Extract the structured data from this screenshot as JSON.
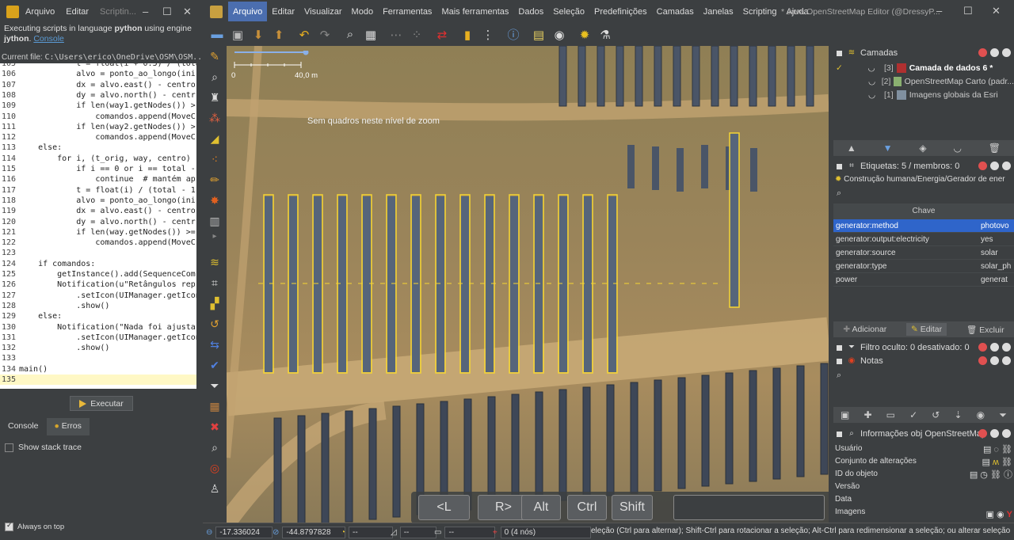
{
  "script_window": {
    "menus": [
      "Arquivo",
      "Editar",
      "Scriptin..."
    ],
    "message": "Executing scripts in language ",
    "language": "python",
    "message2": " using engine ",
    "engine": "jython",
    "message3": ". ",
    "link": "Console",
    "current_file_label": "Current file:",
    "current_file": "C:\\Users\\erico\\OneDrive\\OSM\\OSM...",
    "execute_label": "Executar",
    "tabs": [
      "Console",
      "Erros"
    ],
    "stack_trace_label": "Show stack trace",
    "always_on_top_label": "Always on top"
  },
  "code": {
    "lines": [
      {
        "n": "105",
        "t": "            t = float(i + 0.5) / (total"
      },
      {
        "n": "106",
        "t": "            alvo = ponto_ao_longo(ini"
      },
      {
        "n": "107",
        "t": "            dx = alvo.east() - centro"
      },
      {
        "n": "108",
        "t": "            dy = alvo.north() - centr"
      },
      {
        "n": "109",
        "t": "            if len(way1.getNodes()) >"
      },
      {
        "n": "110",
        "t": "                comandos.append(MoveC"
      },
      {
        "n": "111",
        "t": "            if len(way2.getNodes()) >"
      },
      {
        "n": "112",
        "t": "                comandos.append(MoveC"
      },
      {
        "n": "113",
        "t": "    else:"
      },
      {
        "n": "114",
        "t": "        for i, (t_orig, way, centro) "
      },
      {
        "n": "115",
        "t": "            if i == 0 or i == total -"
      },
      {
        "n": "116",
        "t": "                continue  # mantém ap"
      },
      {
        "n": "117",
        "t": "            t = float(i) / (total - 1"
      },
      {
        "n": "118",
        "t": "            alvo = ponto_ao_longo(ini"
      },
      {
        "n": "119",
        "t": "            dx = alvo.east() - centro"
      },
      {
        "n": "120",
        "t": "            dy = alvo.north() - centr"
      },
      {
        "n": "121",
        "t": "            if len(way.getNodes()) >="
      },
      {
        "n": "122",
        "t": "                comandos.append(MoveC"
      },
      {
        "n": "123",
        "t": ""
      },
      {
        "n": "124",
        "t": "    if comandos:"
      },
      {
        "n": "125",
        "t": "        getInstance().add(SequenceCom"
      },
      {
        "n": "126",
        "t": "        Notification(u\"Retângulos rep"
      },
      {
        "n": "127",
        "t": "            .setIcon(UIManager.getIcon(\"O"
      },
      {
        "n": "128",
        "t": "            .show()"
      },
      {
        "n": "129",
        "t": "    else:"
      },
      {
        "n": "130",
        "t": "        Notification(\"Nada foi ajusta"
      },
      {
        "n": "131",
        "t": "            .setIcon(UIManager.getIcon(\"O"
      },
      {
        "n": "132",
        "t": "            .show()"
      },
      {
        "n": "133",
        "t": ""
      },
      {
        "n": "134",
        "t": "main()"
      },
      {
        "n": "135",
        "t": ""
      }
    ]
  },
  "josm": {
    "menus": [
      "Arquivo",
      "Editar",
      "Visualizar",
      "Modo",
      "Ferramentas",
      "Mais ferramentas",
      "Dados",
      "Seleção",
      "Predefinições",
      "Camadas",
      "Janelas",
      "Scripting",
      "Ajuda"
    ],
    "window_title": "* Java OpenStreetMap Editor (@DressyP..."
  },
  "map": {
    "no_tiles_message": "Sem quadros neste nível de zoom",
    "scale_start": "0",
    "scale_end": "40,0 m",
    "keys": [
      "<L",
      "R>",
      "Alt",
      "Ctrl",
      "Shift"
    ],
    "close_label": "X",
    "panel_rows": 15
  },
  "layers_panel": {
    "title": "Camadas",
    "layers": [
      {
        "num": "[3]",
        "name": "Camada de dados 6 *",
        "active": true
      },
      {
        "num": "[2]",
        "name": "OpenStreetMap Carto (padr..."
      },
      {
        "num": "[1]",
        "name": "Imagens globais da Esri"
      }
    ]
  },
  "tags_panel": {
    "title": "Etiquetas: 5 / membros: 0",
    "preset": "Construção humana/Energia/Gerador de ener",
    "key_header": "Chave",
    "rows": [
      {
        "k": "generator:method",
        "v": "photovo"
      },
      {
        "k": "generator:output:electricity",
        "v": "yes"
      },
      {
        "k": "generator:source",
        "v": "solar"
      },
      {
        "k": "generator:type",
        "v": "solar_ph"
      },
      {
        "k": "power",
        "v": "generat"
      }
    ],
    "add": "Adicionar",
    "edit": "Editar",
    "delete": "Excluir"
  },
  "filter_panel": {
    "title": "Filtro oculto: 0 desativado: 0"
  },
  "notes_panel": {
    "title": "Notas"
  },
  "info_panel": {
    "title": "Informações obj OpenStreetMap",
    "labels": [
      "Usuário",
      "Conjunto de alterações",
      "ID do objeto",
      "Versão",
      "Data",
      "Imagens"
    ]
  },
  "status": {
    "lat": "-17.336024",
    "lon": "-44.8797828",
    "heading": "--",
    "angle": "--",
    "dist": "--",
    "nodes": "0 (4 nós)",
    "help": "eleção (Ctrl para alternar); Shift-Ctrl para rotacionar a seleção; Alt-Ctrl para redimensionar a seleção; ou alterar seleção"
  }
}
